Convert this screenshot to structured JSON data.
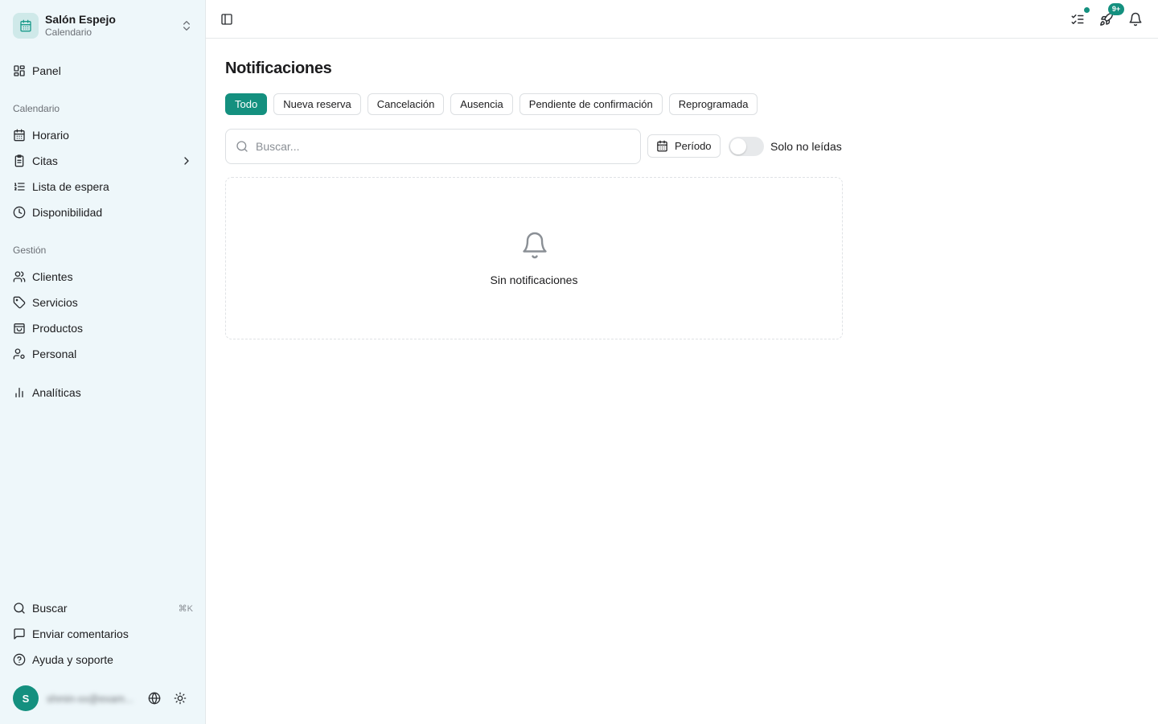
{
  "brand": {
    "name": "Salón Espejo",
    "subtitle": "Calendario"
  },
  "nav": {
    "panel": "Panel",
    "calendar_section": "Calendario",
    "horario": "Horario",
    "citas": "Citas",
    "lista_espera": "Lista de espera",
    "disponibilidad": "Disponibilidad",
    "gestion_section": "Gestión",
    "clientes": "Clientes",
    "servicios": "Servicios",
    "productos": "Productos",
    "personal": "Personal",
    "analiticas": "Analíticas"
  },
  "bottom_nav": {
    "buscar": "Buscar",
    "buscar_shortcut": "⌘K",
    "comentarios": "Enviar comentarios",
    "ayuda": "Ayuda y soporte"
  },
  "user": {
    "initial": "S",
    "email": "shmin-xx@exam..."
  },
  "topbar": {
    "badge": "9+"
  },
  "page": {
    "title": "Notificaciones",
    "filters": [
      {
        "label": "Todo",
        "active": true
      },
      {
        "label": "Nueva reserva",
        "active": false
      },
      {
        "label": "Cancelación",
        "active": false
      },
      {
        "label": "Ausencia",
        "active": false
      },
      {
        "label": "Pendiente de confirmación",
        "active": false
      },
      {
        "label": "Reprogramada",
        "active": false
      }
    ],
    "search_placeholder": "Buscar...",
    "period_label": "Período",
    "unread_only_label": "Solo no leídas",
    "unread_only_value": false,
    "empty_text": "Sin notificaciones"
  },
  "colors": {
    "accent": "#14907f",
    "sidebar_bg": "#eef7fa"
  }
}
